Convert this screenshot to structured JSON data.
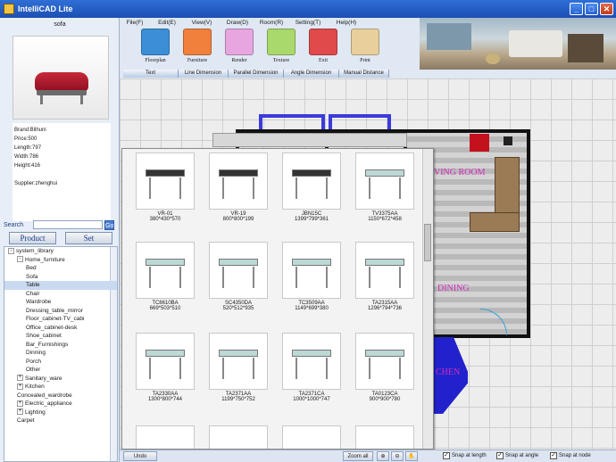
{
  "window": {
    "title": "IntelliCAD Lite"
  },
  "product": {
    "name": "sofa",
    "specs": [
      "Brand:Bilhuni",
      "Price:500",
      "Length:797",
      "Width:786",
      "Height:416",
      "",
      "Supplier:zhenghui"
    ]
  },
  "search": {
    "label": "Search",
    "button": "Go"
  },
  "type_buttons": [
    "Product",
    "Set"
  ],
  "tree": [
    {
      "label": "system_library",
      "level": 0,
      "expand": "-"
    },
    {
      "label": "Home_furniture",
      "level": 1,
      "expand": "-"
    },
    {
      "label": "Bed",
      "level": 2
    },
    {
      "label": "Sofa",
      "level": 2
    },
    {
      "label": "Table",
      "level": 2,
      "selected": true
    },
    {
      "label": "Chair",
      "level": 2
    },
    {
      "label": "Wardrobe",
      "level": 2
    },
    {
      "label": "Dressing_table_mirror",
      "level": 2
    },
    {
      "label": "Floor_cabinet-TV_cabi",
      "level": 2
    },
    {
      "label": "Office_cabinet-desk",
      "level": 2
    },
    {
      "label": "Shoe_cabinet",
      "level": 2
    },
    {
      "label": "Bar_Furnishings",
      "level": 2
    },
    {
      "label": "Dinning",
      "level": 2
    },
    {
      "label": "Porch",
      "level": 2
    },
    {
      "label": "Other",
      "level": 2
    },
    {
      "label": "Sanitary_ware",
      "level": 1,
      "expand": "+"
    },
    {
      "label": "Kitchen",
      "level": 1,
      "expand": "+"
    },
    {
      "label": "Concealed_wardrobe",
      "level": 1
    },
    {
      "label": "Electric_appliance",
      "level": 1,
      "expand": "+"
    },
    {
      "label": "Lighting",
      "level": 1,
      "expand": "+"
    },
    {
      "label": "Carpet",
      "level": 1
    }
  ],
  "menu": [
    "File(F)",
    "Edit(E)",
    "View(V)",
    "Draw(D)",
    "Room(R)",
    "Setting(T)",
    "Help(H)"
  ],
  "big_icons": [
    {
      "label": "Floorplan",
      "color": "#3c8fd6"
    },
    {
      "label": "Furniture",
      "color": "#f0803c"
    },
    {
      "label": "Render",
      "color": "#e7a6e0"
    },
    {
      "label": "Texture",
      "color": "#a9d86c"
    },
    {
      "label": "Exit",
      "color": "#e04a4a"
    },
    {
      "label": "Print",
      "color": "#e8cf9c"
    }
  ],
  "dim_tabs": [
    "Text",
    "Line Dimension",
    "Parallel Dimension",
    "Angle Dimension",
    "Manual Distance"
  ],
  "rooms": [
    "VING ROOM",
    "DINING",
    "CHEN"
  ],
  "catalog": [
    {
      "code": "VR-01",
      "size": "380*430*570"
    },
    {
      "code": "VR-19",
      "size": "800*800*199"
    },
    {
      "code": "JBN15C",
      "size": "1399*799*361"
    },
    {
      "code": "TV3375AA",
      "size": "1150*672*458"
    },
    {
      "code": "TC8610BA",
      "size": "669*503*510"
    },
    {
      "code": "SC4350DA",
      "size": "520*512*935"
    },
    {
      "code": "TC3509AA",
      "size": "1149*699*380"
    },
    {
      "code": "TA2315AA",
      "size": "1296*794*736"
    },
    {
      "code": "TA2330AA",
      "size": "1300*800*744"
    },
    {
      "code": "TA2371AA",
      "size": "1199*750*752"
    },
    {
      "code": "TA2371CA",
      "size": "1000*1000*747"
    },
    {
      "code": "TA0123CA",
      "size": "900*900*780"
    }
  ],
  "statusbar": {
    "undo": "Undo",
    "zoom_all": "Zoom all",
    "checks": [
      {
        "label": "Snap at length",
        "checked": true
      },
      {
        "label": "Snap at angle",
        "checked": true
      },
      {
        "label": "Snap at node",
        "checked": true
      }
    ]
  }
}
